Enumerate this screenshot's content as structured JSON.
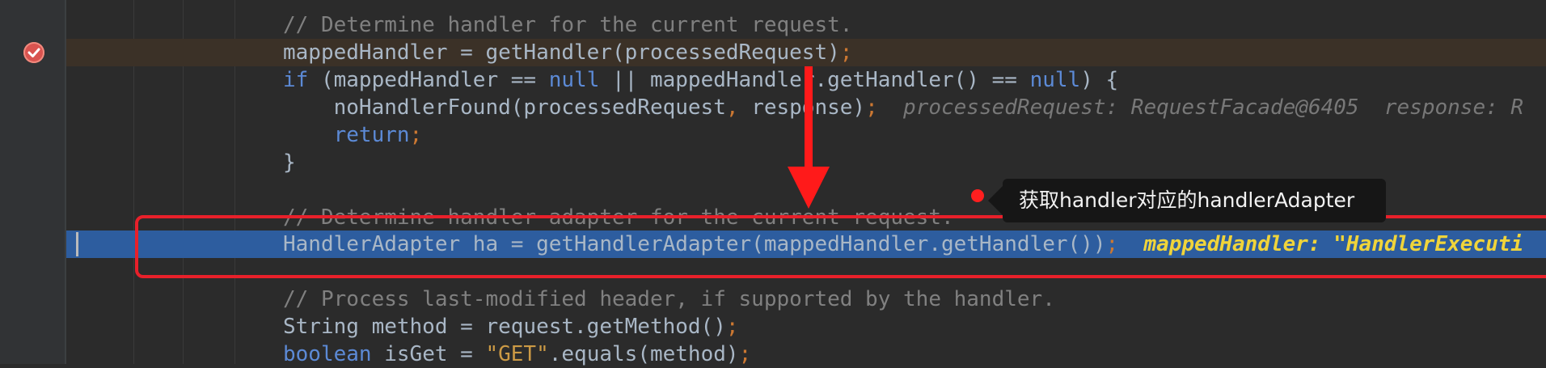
{
  "editor": {
    "lines": [
      {
        "id": "l1",
        "segments": [
          {
            "t": "// Determine handler for the current request.",
            "c": "cm"
          }
        ]
      },
      {
        "id": "l2",
        "segments": [
          {
            "t": "mappedHandler = getHandler(processedRequest)",
            "c": "fn"
          },
          {
            "t": ";",
            "c": "kw"
          }
        ]
      },
      {
        "id": "l3",
        "segments": [
          {
            "t": "if",
            "c": "kwb"
          },
          {
            "t": " (mappedHandler == ",
            "c": "fn"
          },
          {
            "t": "null",
            "c": "kwb"
          },
          {
            "t": " || mappedHandler.getHandler() == ",
            "c": "fn"
          },
          {
            "t": "null",
            "c": "kwb"
          },
          {
            "t": ") {",
            "c": "fn"
          }
        ]
      },
      {
        "id": "l4",
        "segments": [
          {
            "t": "    noHandlerFound(processedRequest",
            "c": "fn"
          },
          {
            "t": ", ",
            "c": "kw"
          },
          {
            "t": "response)",
            "c": "fn"
          },
          {
            "t": ";",
            "c": "kw"
          },
          {
            "t": "  processedRequest: RequestFacade@6405  response: R",
            "c": "hint"
          }
        ]
      },
      {
        "id": "l5",
        "segments": [
          {
            "t": "    return",
            "c": "kwb"
          },
          {
            "t": ";",
            "c": "kw"
          }
        ]
      },
      {
        "id": "l6",
        "segments": [
          {
            "t": "}",
            "c": "fn"
          }
        ]
      },
      {
        "id": "l7",
        "segments": [
          {
            "t": "// Determine handler adapter for the current request.",
            "c": "cm"
          }
        ]
      },
      {
        "id": "l8",
        "segments": [
          {
            "t": "HandlerAdapter ha = getHandlerAdapter(mappedHandler.getHandler())",
            "c": "fn"
          },
          {
            "t": ";",
            "c": "kw"
          },
          {
            "t": "  mappedHandler: \"HandlerExecuti",
            "c": "hint-yellow"
          }
        ]
      },
      {
        "id": "l9",
        "segments": [
          {
            "t": "// Process last-modified header, if supported by the handler.",
            "c": "cm"
          }
        ]
      },
      {
        "id": "l10",
        "segments": [
          {
            "t": "String method = request.getMethod()",
            "c": "fn"
          },
          {
            "t": ";",
            "c": "kw"
          }
        ]
      },
      {
        "id": "l11",
        "segments": [
          {
            "t": "boolean",
            "c": "kwb"
          },
          {
            "t": " isGet = ",
            "c": "fn"
          },
          {
            "t": "\"GET\"",
            "c": "gold"
          },
          {
            "t": ".equals(method)",
            "c": "fn"
          },
          {
            "t": ";",
            "c": "kw"
          }
        ]
      }
    ]
  },
  "annotation": {
    "tooltip_text": "获取handler对应的handlerAdapter"
  },
  "colors": {
    "background": "#2b2b2b",
    "current_line": "#2d5d9f",
    "breakpoint_line": "#3b3127",
    "annotation_red": "#e8202a"
  },
  "icons": {
    "breakpoint": "breakpoint-check-icon",
    "arrow": "red-down-arrow-icon"
  }
}
